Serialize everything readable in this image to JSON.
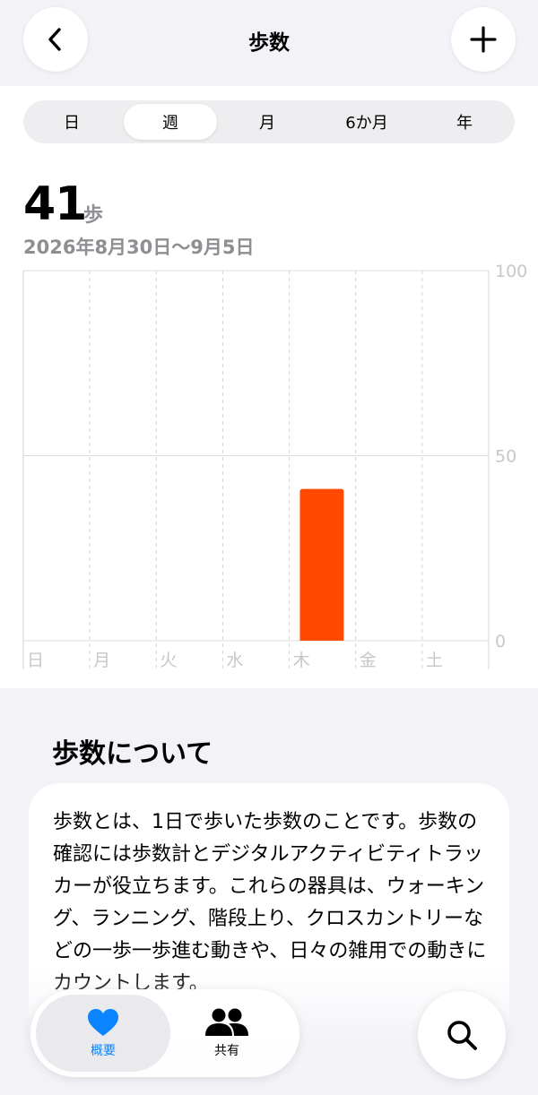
{
  "header": {
    "title": "歩数"
  },
  "segments": [
    {
      "label": "日",
      "active": false
    },
    {
      "label": "週",
      "active": true
    },
    {
      "label": "月",
      "active": false
    },
    {
      "label": "6か月",
      "active": false
    },
    {
      "label": "年",
      "active": false
    }
  ],
  "summary": {
    "value": "41",
    "unit": "歩",
    "date_range": "2026年8月30日〜9月5日"
  },
  "chart_data": {
    "type": "bar",
    "categories": [
      "日",
      "月",
      "火",
      "水",
      "木",
      "金",
      "土"
    ],
    "values": [
      0,
      0,
      0,
      0,
      41,
      0,
      0
    ],
    "ylim": [
      0,
      100
    ],
    "yticks": [
      "100",
      "50",
      "0"
    ],
    "grid": true,
    "bar_color": "#ff4a00"
  },
  "about": {
    "title": "歩数について",
    "body": "歩数とは、1日で歩いた歩数のことです。歩数の確認には歩数計とデジタルアクティビティトラッカーが役立ちます。これらの器具は、ウォーキング、ランニング、階段上り、クロスカントリーなどの一歩一歩進む動きや、日々の雑用での動きにカウントします。"
  },
  "tabbar": {
    "items": [
      {
        "label": "概要",
        "icon": "heart-icon",
        "active": true,
        "color": "#0a84ff"
      },
      {
        "label": "共有",
        "icon": "people-icon",
        "active": false,
        "color": "#000000"
      }
    ]
  },
  "colors": {
    "accent": "#0a84ff",
    "bar": "#ff4a00",
    "secondary_text": "#8e8e93"
  }
}
